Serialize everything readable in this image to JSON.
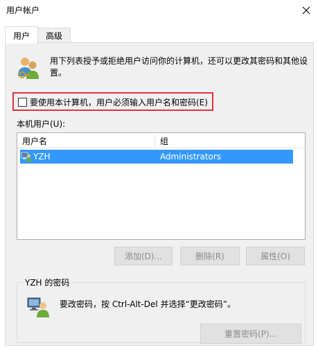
{
  "window": {
    "title": "用户帐户"
  },
  "tabs": [
    {
      "label": "用户",
      "active": true
    },
    {
      "label": "高级",
      "active": false
    }
  ],
  "intro": {
    "text": "用下列表授予或拒绝用户访问你的计算机，还可以更改其密码和其他设置。"
  },
  "require_login": {
    "label": "要使用本计算机，用户必须输入用户名和密码(E)",
    "checked": false
  },
  "users_section": {
    "label": "本机用户(U):",
    "columns": [
      "用户名",
      "组"
    ],
    "rows": [
      {
        "username": "YZH",
        "group": "Administrators",
        "selected": true
      }
    ]
  },
  "buttons": {
    "add": "添加(D)...",
    "remove": "删除(R)",
    "properties": "属性(O)"
  },
  "password_group": {
    "title": "YZH 的密码",
    "text": "要改密码，按 Ctrl-Alt-Del 并选择“更改密码”。",
    "reset_button": "重置密码(P)..."
  },
  "colors": {
    "selection": "#3399ff",
    "highlight_border": "#e0323a",
    "panel_bg": "#f0f0f0"
  }
}
